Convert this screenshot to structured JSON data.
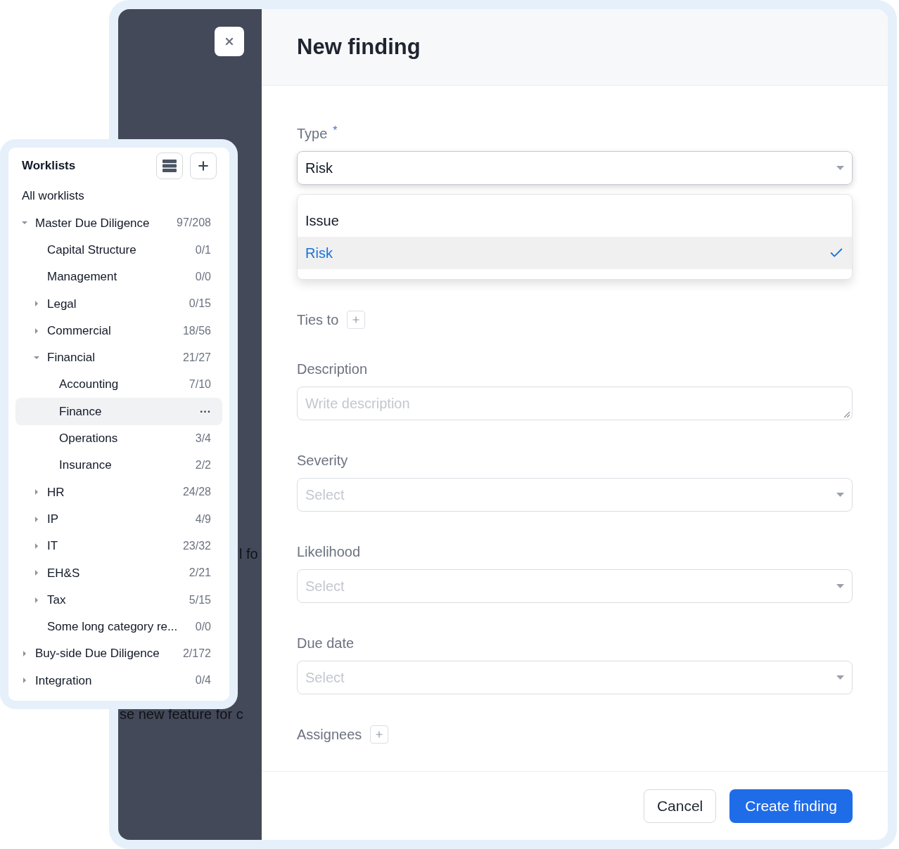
{
  "worklists": {
    "title": "Worklists",
    "all_label": "All worklists",
    "tree": [
      {
        "label": "Master Due Diligence",
        "count": "97/208",
        "expanded": true,
        "selected": false,
        "children": [
          {
            "label": "Capital Structure",
            "count": "0/1",
            "selected": false
          },
          {
            "label": "Management",
            "count": "0/0",
            "selected": false
          },
          {
            "label": "Legal",
            "count": "0/15",
            "expanded": false,
            "selected": false
          },
          {
            "label": "Commercial",
            "count": "18/56",
            "expanded": false,
            "selected": false
          },
          {
            "label": "Financial",
            "count": "21/27",
            "expanded": true,
            "selected": false,
            "children": [
              {
                "label": "Accounting",
                "count": "7/10",
                "selected": false
              },
              {
                "label": "Finance",
                "menu": "···",
                "selected": true
              },
              {
                "label": "Operations",
                "count": "3/4",
                "selected": false
              },
              {
                "label": "Insurance",
                "count": "2/2",
                "selected": false
              }
            ]
          },
          {
            "label": "HR",
            "count": "24/28",
            "expanded": false,
            "selected": false
          },
          {
            "label": "IP",
            "count": "4/9",
            "expanded": false,
            "selected": false
          },
          {
            "label": "IT",
            "count": "23/32",
            "expanded": false,
            "selected": false
          },
          {
            "label": "EH&S",
            "count": "2/21",
            "expanded": false,
            "selected": false
          },
          {
            "label": "Tax",
            "count": "5/15",
            "expanded": false,
            "selected": false
          },
          {
            "label": "Some long category re...",
            "count": "0/0",
            "selected": false
          }
        ]
      },
      {
        "label": "Buy-side Due Diligence",
        "count": "2/172",
        "expanded": false,
        "selected": false
      },
      {
        "label": "Integration",
        "count": "0/4",
        "expanded": false,
        "selected": false
      }
    ]
  },
  "background_text": [
    "l fo",
    "se new feature for c"
  ],
  "dialog": {
    "title": "New finding",
    "fields": [
      {
        "kind": "select",
        "label": "Type",
        "required_mark": "*",
        "value": "Risk",
        "expanded": true,
        "options": [
          {
            "label": "Issue",
            "selected": false
          },
          {
            "label": "Risk",
            "selected": true
          }
        ]
      },
      {
        "kind": "add",
        "label": "Ties to"
      },
      {
        "kind": "textarea",
        "label": "Description",
        "placeholder": "Write description"
      },
      {
        "kind": "select",
        "label": "Severity",
        "placeholder": "Select",
        "expanded": false
      },
      {
        "kind": "select",
        "label": "Likelihood",
        "placeholder": "Select",
        "expanded": false
      },
      {
        "kind": "select",
        "label": "Due date",
        "placeholder": "Select",
        "expanded": false
      },
      {
        "kind": "add",
        "label": "Assignees"
      }
    ],
    "buttons": [
      {
        "label": "Cancel",
        "kind": "secondary"
      },
      {
        "label": "Create finding",
        "kind": "primary"
      }
    ]
  }
}
